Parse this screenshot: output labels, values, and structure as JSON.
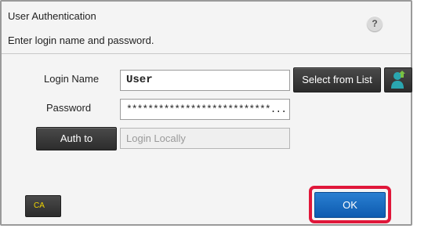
{
  "dialog": {
    "title": "User Authentication",
    "help_label": "?",
    "subtitle": "Enter login name and password."
  },
  "login_name": {
    "label": "Login Name",
    "value": "User"
  },
  "select_from_list": {
    "label": "Select from List"
  },
  "user_icon": {
    "name": "user-add-icon",
    "colors": {
      "person": "#2aa6b0",
      "arrow": "#7ac143"
    }
  },
  "password": {
    "label": "Password",
    "value": "***************************..."
  },
  "auth_to": {
    "button_label": "Auth to",
    "value": "Login Locally"
  },
  "footer": {
    "ca_label": "CA",
    "ok_label": "OK"
  },
  "colors": {
    "ok_button": "#1a6cc2",
    "highlight": "#e0173a",
    "ca_text": "#f0d400"
  }
}
